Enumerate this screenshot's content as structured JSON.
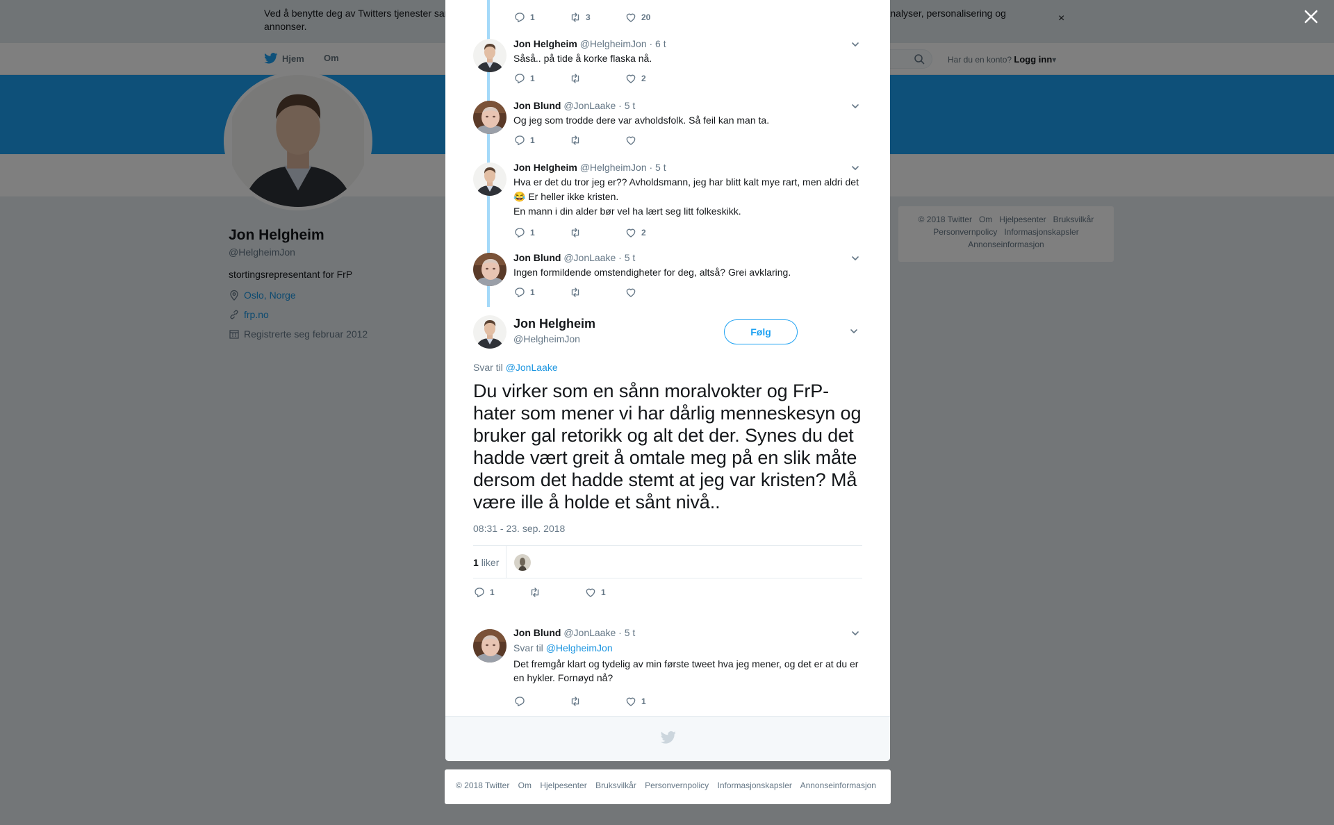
{
  "cookie_banner": {
    "text": "Ved å benytte deg av Twitters tjenester samtykker du i vår bruk av informasjonskapsler. Vi og våre partnere benytter informasjonskapsler til bl.a. analyser, personalisering og annonser.",
    "close_glyph": "×"
  },
  "nav": {
    "home": "Hjem",
    "about": "Om",
    "account_prompt": "Har du en konto?",
    "login": "Logg inn"
  },
  "profile": {
    "name": "Jon Helgheim",
    "handle": "@HelgheimJon",
    "bio": "stortingsrepresentant for FrP",
    "location": "Oslo, Norge",
    "website": "frp.no",
    "joined": "Registrerte seg februar 2012"
  },
  "side_footer": {
    "line1": [
      "© 2018 Twitter",
      "Om",
      "Hjelpesenter",
      "Bruksvilkår"
    ],
    "line2": [
      "Personvernpolicy",
      "Informasjonskapsler"
    ],
    "line3": [
      "Annonseinformasjon"
    ]
  },
  "thread": [
    {
      "actions": {
        "replies": "1",
        "retweets": "3",
        "likes": "20"
      }
    },
    {
      "name": "Jon Helgheim",
      "handle": "@HelgheimJon",
      "time": "· 6 t",
      "text": "Såså.. på tide å korke flaska nå.",
      "actions": {
        "replies": "1",
        "retweets": "",
        "likes": "2"
      }
    },
    {
      "name": "Jon Blund",
      "handle": "@JonLaake",
      "time": "· 5 t",
      "text": "Og jeg som trodde dere var avholdsfolk. Så feil kan man ta.",
      "actions": {
        "replies": "1",
        "retweets": "",
        "likes": ""
      }
    },
    {
      "name": "Jon Helgheim",
      "handle": "@HelgheimJon",
      "time": "· 5 t",
      "text_line1": "Hva er det du tror jeg er?? Avholdsmann, jeg har blitt kalt mye rart, men aldri det",
      "text_line2": "😂 Er heller ikke kristen.",
      "text_line3": "En mann i din alder bør vel ha lært seg litt folkeskikk.",
      "actions": {
        "replies": "1",
        "retweets": "",
        "likes": "2"
      }
    },
    {
      "name": "Jon Blund",
      "handle": "@JonLaake",
      "time": "· 5 t",
      "text": "Ingen formildende omstendigheter for deg, altså? Grei avklaring.",
      "actions": {
        "replies": "1",
        "retweets": "",
        "likes": ""
      }
    }
  ],
  "main_tweet": {
    "name": "Jon Helgheim",
    "handle": "@HelgheimJon",
    "follow_label": "Følg",
    "reply_prefix": "Svar til",
    "reply_to": "@JonLaake",
    "text": "Du virker som en sånn moralvokter og FrP-hater som mener vi har dårlig menneskesyn og bruker gal retorikk og alt det der. Synes du det hadde vært greit å omtale meg på en slik måte dersom det hadde stemt at jeg var kristen? Må være ille å holde et sånt nivå..",
    "timestamp": "08:31 - 23. sep. 2018",
    "likes_count": "1",
    "likes_label": "liker",
    "actions": {
      "replies": "1",
      "retweets": "",
      "likes": "1"
    }
  },
  "reply_tweet": {
    "name": "Jon Blund",
    "handle": "@JonLaake",
    "time": "· 5 t",
    "reply_prefix": "Svar til",
    "reply_to": "@HelgheimJon",
    "text": "Det fremgår klart og tydelig av min første tweet hva jeg mener, og det er at du er en hykler. Fornøyd nå?",
    "actions": {
      "replies": "",
      "retweets": "",
      "likes": "1"
    }
  },
  "bottom_footer": [
    "© 2018 Twitter",
    "Om",
    "Hjelpesenter",
    "Bruksvilkår",
    "Personvernpolicy",
    "Informasjonskapsler",
    "Annonseinformasjon"
  ],
  "colors": {
    "brand_blue": "#1da1f2",
    "link": "#1b95e0",
    "thread_line": "#a4d9f9",
    "muted": "#657786"
  },
  "icons": [
    "twitter-bird-icon",
    "search-icon",
    "close-icon",
    "reply-icon",
    "retweet-icon",
    "heart-icon",
    "chevron-down-icon",
    "location-icon",
    "link-icon",
    "calendar-icon"
  ]
}
